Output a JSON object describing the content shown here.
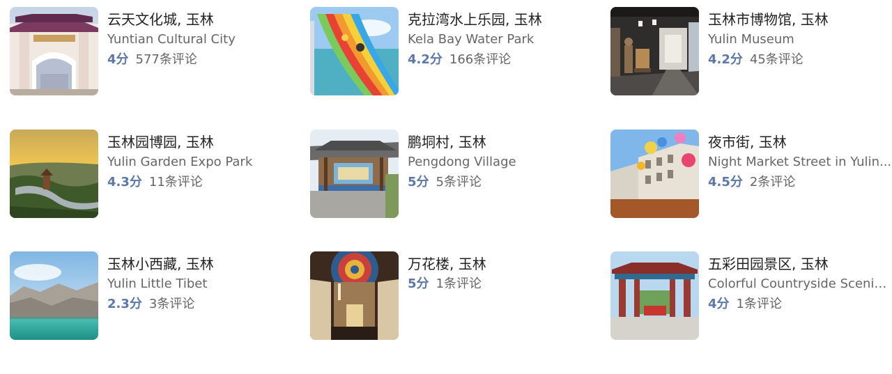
{
  "attractions": [
    {
      "title": "云天文化城, 玉林",
      "subtitle": "Yuntian Cultural City",
      "score": "4分",
      "reviews": "577条评论"
    },
    {
      "title": "克拉湾水上乐园, 玉林",
      "subtitle": "Kela Bay Water Park",
      "score": "4.2分",
      "reviews": "166条评论"
    },
    {
      "title": "玉林市博物馆, 玉林",
      "subtitle": "Yulin Museum",
      "score": "4.2分",
      "reviews": "45条评论"
    },
    {
      "title": "玉林园博园, 玉林",
      "subtitle": "Yulin Garden Expo Park",
      "score": "4.3分",
      "reviews": "11条评论"
    },
    {
      "title": "鹏垌村, 玉林",
      "subtitle": "Pengdong Village",
      "score": "5分",
      "reviews": "5条评论"
    },
    {
      "title": "夜市街, 玉林",
      "subtitle": "Night Market Street in Yulin...",
      "score": "4.5分",
      "reviews": "2条评论"
    },
    {
      "title": "玉林小西藏, 玉林",
      "subtitle": "Yulin Little Tibet",
      "score": "2.3分",
      "reviews": "3条评论"
    },
    {
      "title": "万花楼, 玉林",
      "subtitle": "",
      "score": "5分",
      "reviews": "1条评论"
    },
    {
      "title": "五彩田园景区, 玉林",
      "subtitle": "Colorful Countryside Scenic...",
      "score": "4分",
      "reviews": "1条评论"
    }
  ]
}
